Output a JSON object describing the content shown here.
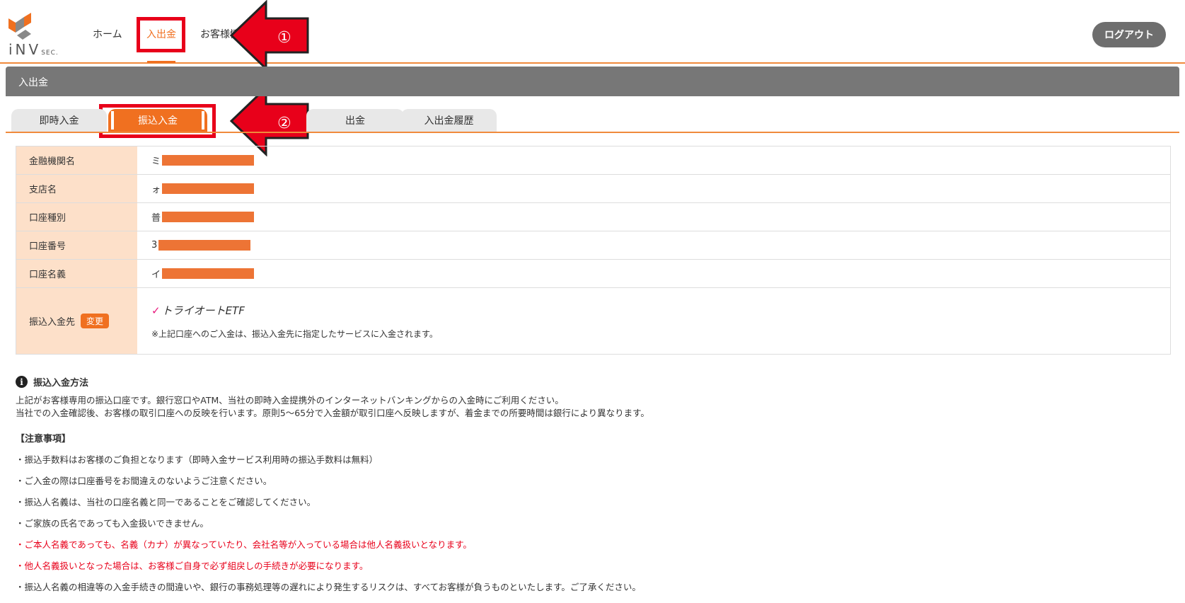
{
  "header": {
    "logo_text": "iNV",
    "logo_sub": "SEC.",
    "nav": [
      {
        "label": "ホーム",
        "active": false
      },
      {
        "label": "入出金",
        "active": true
      },
      {
        "label": "お客様情",
        "active": false
      }
    ],
    "logout_label": "ログアウト"
  },
  "annotations": {
    "marker1": "①",
    "marker2": "②"
  },
  "section": {
    "title": "入出金"
  },
  "tabs": [
    {
      "label": "即時入金",
      "active": false
    },
    {
      "label": "振込入金",
      "active": true
    },
    {
      "label": "出金",
      "active": false
    },
    {
      "label": "入出金履歴",
      "active": false
    }
  ],
  "account": {
    "rows": [
      {
        "label": "金融機関名",
        "value_prefix": "ミ"
      },
      {
        "label": "支店名",
        "value_prefix": "ォ"
      },
      {
        "label": "口座種別",
        "value_prefix": "普"
      },
      {
        "label": "口座番号",
        "value_prefix": "3"
      },
      {
        "label": "口座名義",
        "value_prefix": "イ"
      }
    ],
    "destination": {
      "label": "振込入金先",
      "change_label": "変更",
      "service_name": "トライオートETF",
      "note": "※上記口座へのご入金は、振込入金先に指定したサービスに入金されます。"
    }
  },
  "method": {
    "title": "振込入金方法",
    "desc": [
      "上記がお客様専用の振込口座です。銀行窓口やATM、当社の即時入金提携外のインターネットバンキングからの入金時にご利用ください。",
      "当社での入金確認後、お客様の取引口座への反映を行います。原則5～65分で入金額が取引口座へ反映しますが、着金までの所要時間は銀行により異なります。"
    ],
    "notice_title": "【注意事項】",
    "notices": [
      {
        "text": "・振込手数料はお客様のご負担となります（即時入金サービス利用時の振込手数料は無料）",
        "red": false
      },
      {
        "text": "・ご入金の際は口座番号をお間違えのないようご注意ください。",
        "red": false
      },
      {
        "text": "・振込人名義は、当社の口座名義と同一であることをご確認してください。",
        "red": false
      },
      {
        "text": "・ご家族の氏名であっても入金扱いできません。",
        "red": false
      },
      {
        "text": "・ご本人名義であっても、名義（カナ）が異なっていたり、会社名等が入っている場合は他人名義扱いとなります。",
        "red": true
      },
      {
        "text": "・他人名義扱いとなった場合は、お客様ご自身で必ず組戻しの手続きが必要になります。",
        "red": true
      },
      {
        "text": "・振込人名義の相違等の入金手続きの間違いや、銀行の事務処理等の遅れにより発生するリスクは、すべてお客様が負うものといたします。ご了承ください。",
        "red": false
      }
    ]
  }
}
